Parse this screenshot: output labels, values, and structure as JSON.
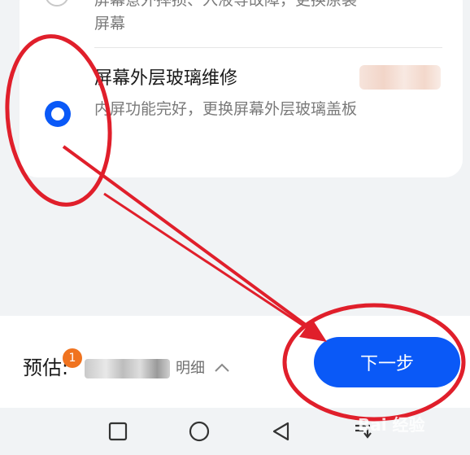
{
  "options": [
    {
      "title": "",
      "description": "屏幕意外摔损、入液等故障，更换原装屏幕",
      "selected": false
    },
    {
      "title": "屏幕外层玻璃维修",
      "description": "内屏功能完好，更换屏幕外层玻璃盖板",
      "selected": true
    }
  ],
  "footer": {
    "estimate_label": "预估:",
    "badge_count": "1",
    "detail_label": "明细",
    "next_button": "下一步"
  },
  "nav_icons": [
    "recent-apps-square-icon",
    "home-circle-icon",
    "back-triangle-icon",
    "notification-pull-icon"
  ],
  "annotation_color": "#e01f2b",
  "accent_color": "#0a59f7",
  "watermark": "Bai 经验"
}
